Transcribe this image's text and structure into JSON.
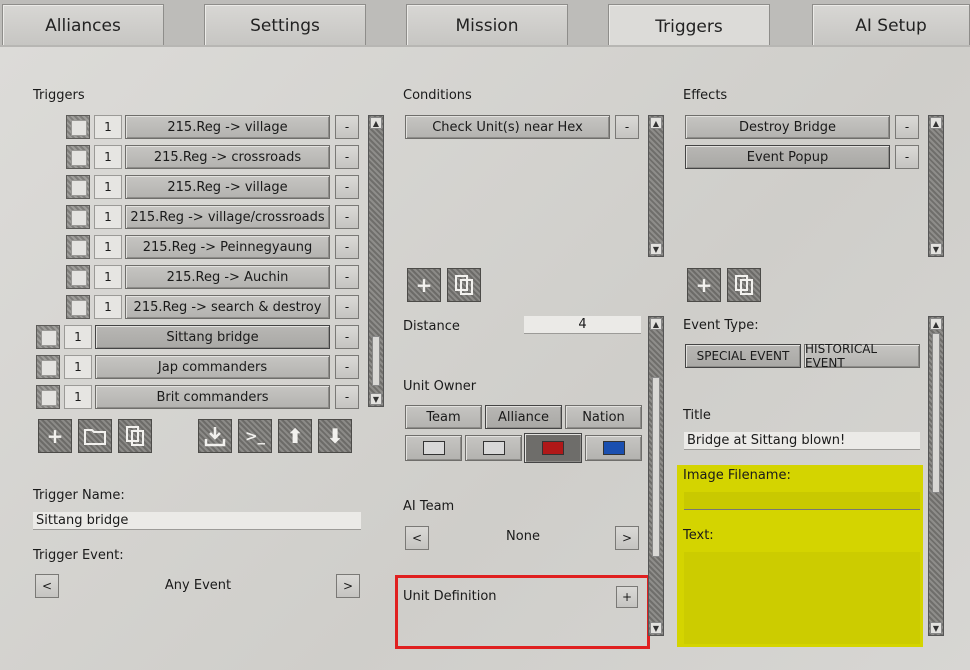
{
  "tabs": [
    "Alliances",
    "Settings",
    "Mission",
    "Triggers",
    "AI Setup"
  ],
  "triggers": {
    "heading": "Triggers",
    "rows": [
      {
        "count": "1",
        "label": "215.Reg -> village",
        "remove": "-"
      },
      {
        "count": "1",
        "label": "215.Reg -> crossroads",
        "remove": "-"
      },
      {
        "count": "1",
        "label": "215.Reg -> village",
        "remove": "-"
      },
      {
        "count": "1",
        "label": "215.Reg -> village/crossroads",
        "remove": "-"
      },
      {
        "count": "1",
        "label": "215.Reg -> Peinnegyaung",
        "remove": "-"
      },
      {
        "count": "1",
        "label": "215.Reg -> Auchin",
        "remove": "-"
      },
      {
        "count": "1",
        "label": "215.Reg -> search & destroy",
        "remove": "-"
      },
      {
        "count": "1",
        "label": "Sittang bridge",
        "remove": "-"
      },
      {
        "count": "1",
        "label": "Jap commanders",
        "remove": "-"
      },
      {
        "count": "1",
        "label": "Brit commanders",
        "remove": "-"
      }
    ],
    "name_label": "Trigger Name:",
    "name_value": "Sittang bridge",
    "event_label": "Trigger Event:",
    "event_value": "Any Event",
    "prev": "<",
    "next": ">"
  },
  "conditions": {
    "heading": "Conditions",
    "items": [
      {
        "label": "Check Unit(s) near Hex",
        "remove": "-"
      }
    ],
    "distance_label": "Distance",
    "distance_value": "4",
    "owner_label": "Unit Owner",
    "owner_options": [
      "Team",
      "Alliance",
      "Nation"
    ],
    "owner_selected": "Alliance",
    "swatch_colors": [
      "#d8d8d8",
      "#d8d8d8",
      "#b01818",
      "#1a4fb0"
    ],
    "ai_team_label": "AI Team",
    "ai_team_value": "None",
    "prev": "<",
    "next": ">",
    "unit_def_label": "Unit Definition",
    "unit_def_add": "+"
  },
  "effects": {
    "heading": "Effects",
    "items": [
      {
        "label": "Destroy Bridge",
        "remove": "-"
      },
      {
        "label": "Event Popup",
        "remove": "-"
      }
    ],
    "event_type_label": "Event Type:",
    "event_types": [
      "SPECIAL EVENT",
      "HISTORICAL EVENT"
    ],
    "title_label": "Title",
    "title_value": "Bridge at Sittang blown!",
    "image_label": "Image Filename:",
    "image_value": "",
    "text_label": "Text:",
    "text_value": ""
  },
  "colors": {
    "highlight_yellow": "#d4d400",
    "outline_red": "#e02020"
  }
}
